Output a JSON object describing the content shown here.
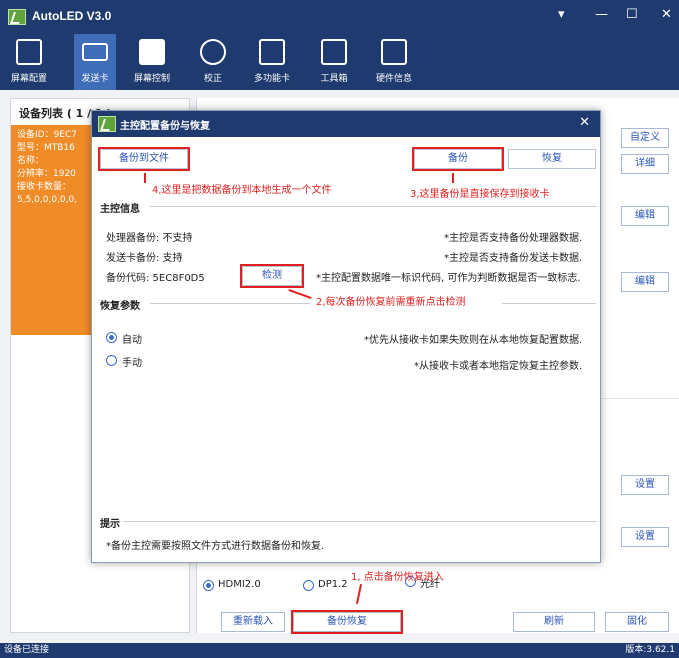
{
  "app": {
    "title": "AutoLED V3.0"
  },
  "window_buttons": {
    "menu": "▾",
    "minimize": "—",
    "maximize": "☐",
    "close": "✕"
  },
  "toolbar": {
    "items": [
      {
        "label": "屏幕配置"
      },
      {
        "label": "发送卡"
      },
      {
        "label": "屏幕控制"
      },
      {
        "label": "校正"
      },
      {
        "label": "多功能卡"
      },
      {
        "label": "工具箱"
      },
      {
        "label": "硬件信息"
      }
    ]
  },
  "left_panel": {
    "title": "设备列表 ( 1 / 1 ):",
    "device_lines": [
      "设备ID：9EC7",
      "型号：MTB16",
      "名称：",
      "分辨率：1920",
      "接收卡数量：",
      "5,5,0,0,0,0,0,"
    ]
  },
  "right_panel": {
    "custom_button": "自定义",
    "detail_button": "详细",
    "edit_button_1": "编辑",
    "edit_button_2": "编辑",
    "setting_button_1": "设置",
    "setting_button_2": "设置",
    "input_options": [
      "HDMI2.0",
      "DP1.2",
      "光纤"
    ],
    "bottom_buttons": {
      "reload": "重新载入",
      "backup_restore": "备份恢复",
      "refresh": "刷新",
      "solidify": "固化"
    },
    "annotation": "1, 点击备份恢复进入"
  },
  "dialog": {
    "title": "主控配置备份与恢复",
    "close": "✕",
    "buttons": {
      "backup_to_file": "备份到文件",
      "backup": "备份",
      "restore": "恢复",
      "detect": "检测"
    },
    "annotations": {
      "a4": "4,这里是把数据备份到本地生成一个文件",
      "a3": "3,这里备份是直接保存到接收卡",
      "a2": "2,每次备份恢复前需重新点击检测"
    },
    "controller_info": {
      "title": "主控信息",
      "processor_label": "处理器备份:  不支持",
      "processor_note": "*主控是否支持备份处理器数据.",
      "sender_label": "发送卡备份:  支持",
      "sender_note": "*主控是否支持备份发送卡数据.",
      "code_label": "备份代码:  5EC8F0D5",
      "code_note": "*主控配置数据唯一标识代码, 可作为判断数据是否一致标志."
    },
    "restore_params": {
      "title": "恢复参数",
      "auto_label": "自动",
      "auto_note": "*优先从接收卡如果失败则在从本地恢复配置数据.",
      "manual_label": "手动",
      "manual_note": "*从接收卡或者本地指定恢复主控参数."
    },
    "tips": {
      "title": "提示",
      "text": "*备份主控需要按照文件方式进行数据备份和恢复."
    }
  },
  "status": {
    "left": "设备已连接",
    "version": "版本:3.62.1"
  },
  "colors": {
    "navy": "#1e3a6e",
    "accent": "#3f6db8",
    "orange": "#f08c28",
    "red": "#e02020"
  }
}
